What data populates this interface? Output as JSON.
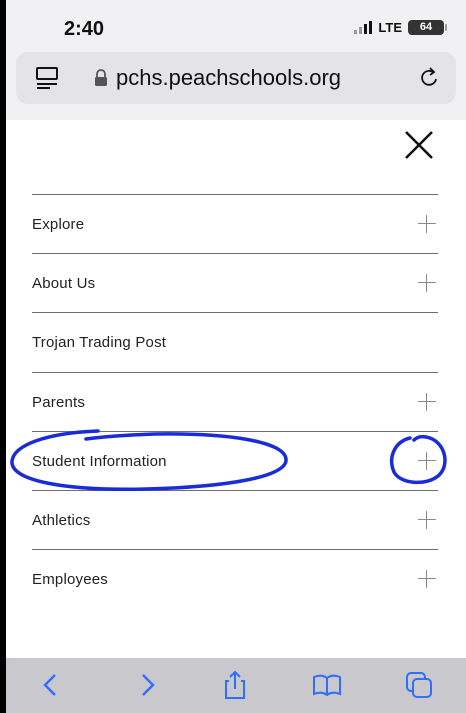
{
  "status_bar": {
    "time": "2:40",
    "network": "LTE",
    "battery": "64"
  },
  "address_bar": {
    "url": "pchs.peachschools.org",
    "icons": [
      "reader-icon",
      "lock-icon",
      "reload-icon"
    ]
  },
  "menu": {
    "close_icon": "close-icon",
    "items": [
      {
        "label": "Explore",
        "expandable": true
      },
      {
        "label": "About Us",
        "expandable": true
      },
      {
        "label": "Trojan Trading Post",
        "expandable": false
      },
      {
        "label": "Parents",
        "expandable": true
      },
      {
        "label": "Student Information",
        "expandable": true
      },
      {
        "label": "Athletics",
        "expandable": true
      },
      {
        "label": "Employees",
        "expandable": true
      }
    ]
  },
  "annotations": {
    "color": "#1a2cd9",
    "circled": [
      "Student Information",
      "expand-plus"
    ]
  },
  "bottom_toolbar": {
    "icons": [
      "back-icon",
      "forward-icon",
      "share-icon",
      "bookmarks-icon",
      "tabs-icon"
    ],
    "accent": "#2f6fff"
  },
  "colors": {
    "chrome_bg": "#f1f1f3",
    "toolbar_bg": "#c8c8cd",
    "text": "#222222"
  }
}
